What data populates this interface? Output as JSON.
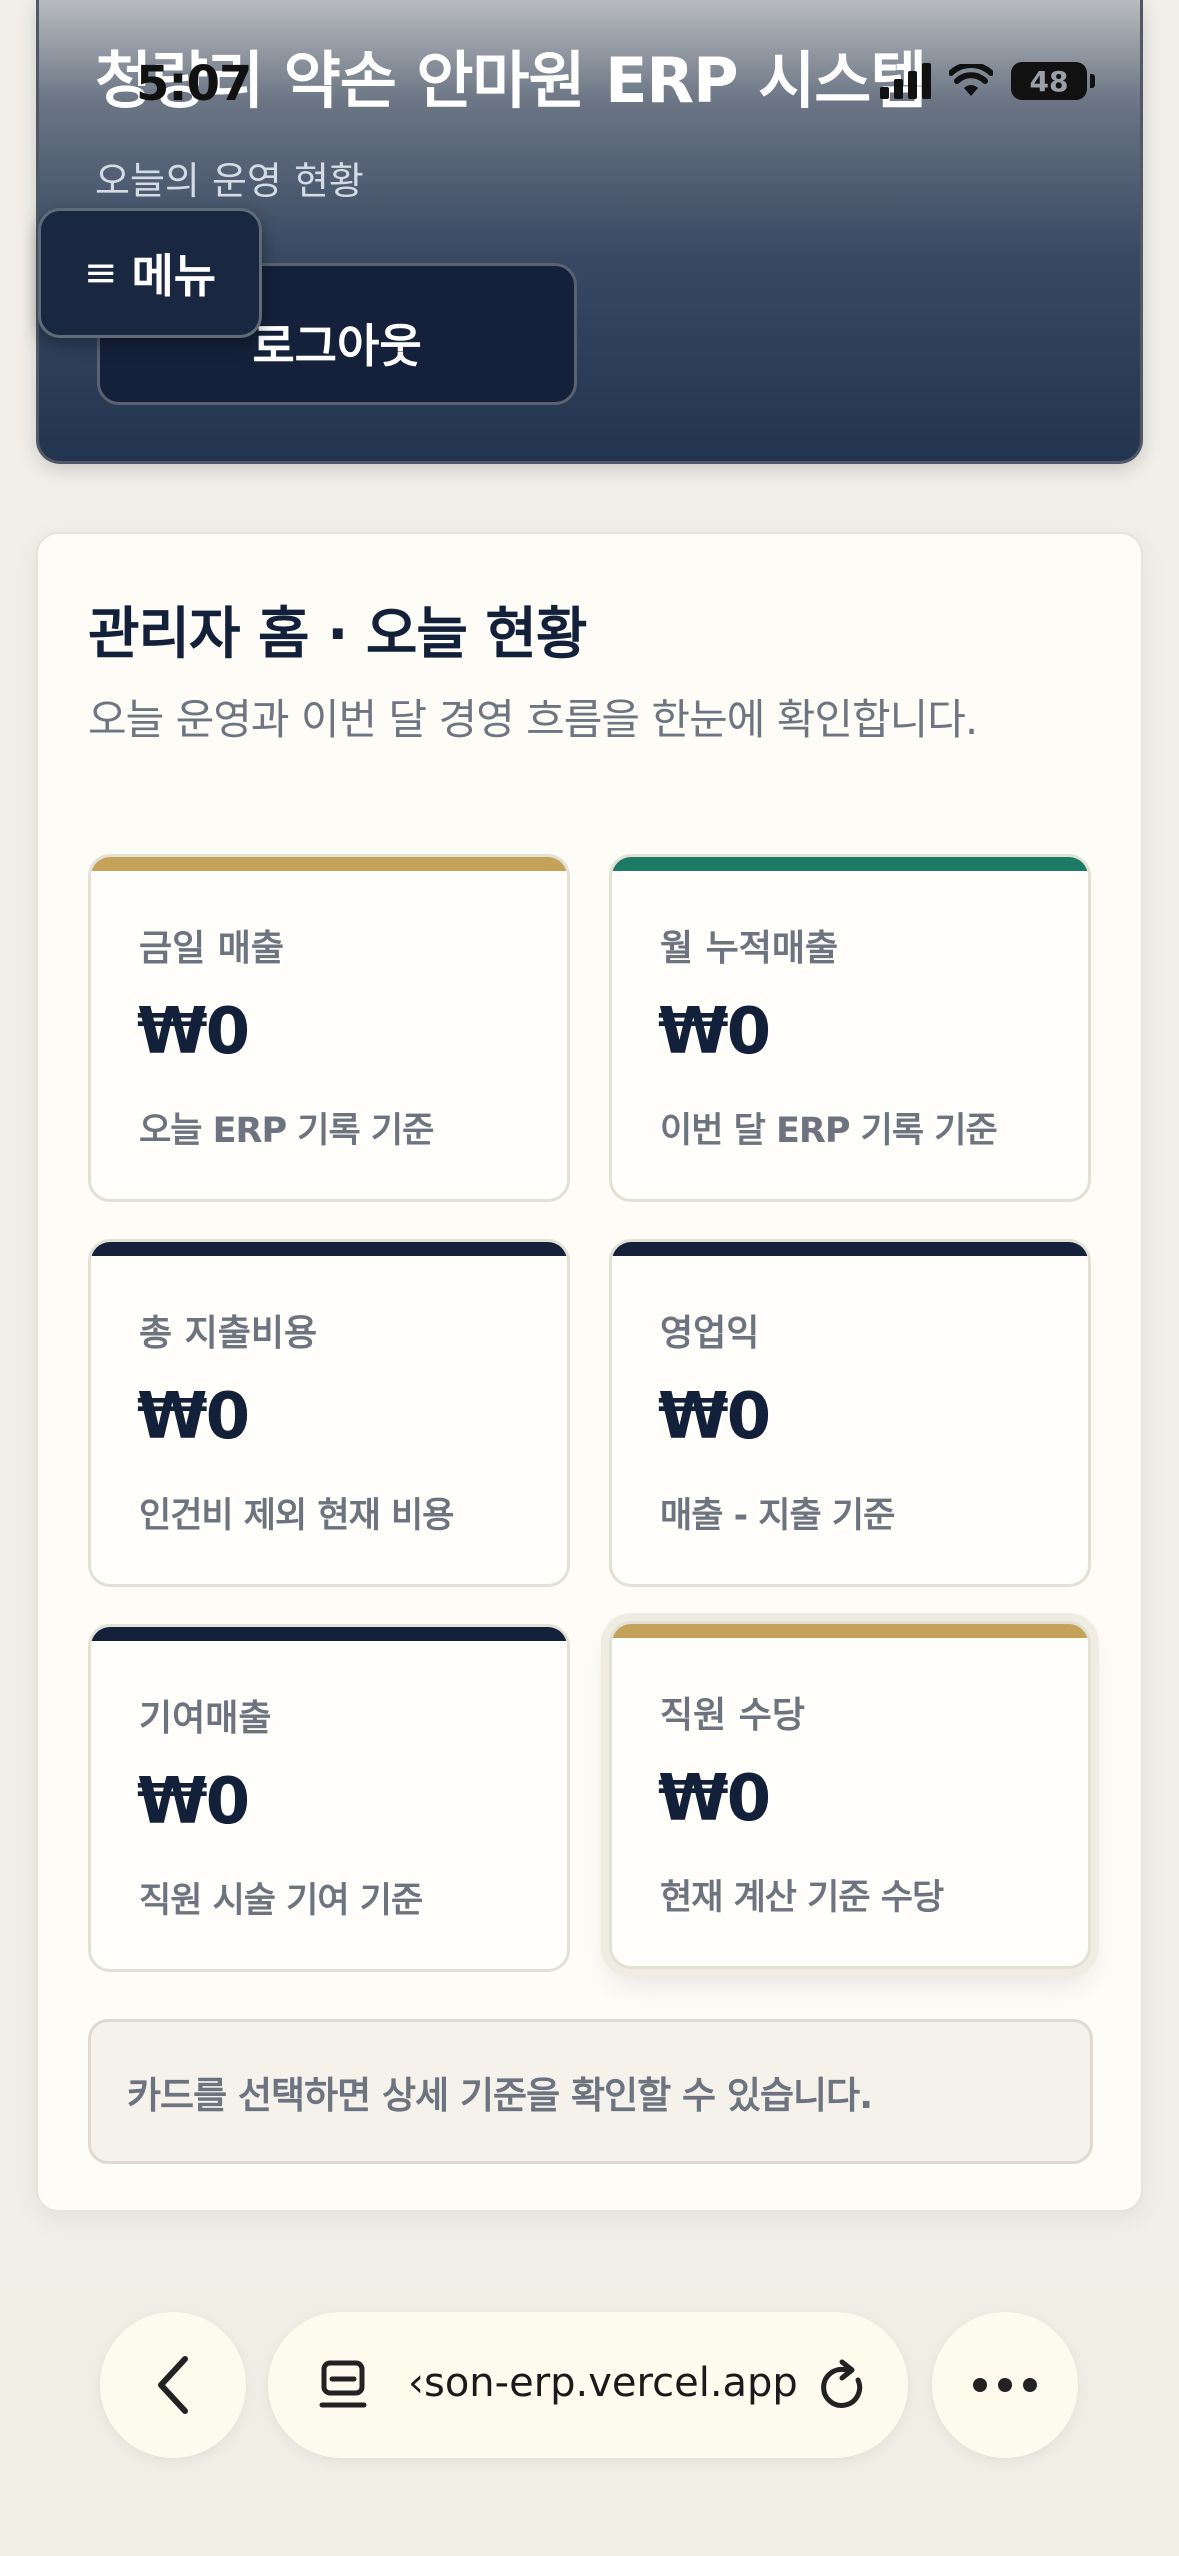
{
  "status_bar": {
    "time": "5:07",
    "battery": "48"
  },
  "header": {
    "title": "청량리 약손 안마원 ERP 시스템",
    "subtitle": "오늘의 운영 현황",
    "logout_label": "로그아웃",
    "menu_label": "메뉴",
    "menu_icon": "≡"
  },
  "main": {
    "title": "관리자 홈 · 오늘 현황",
    "description": "오늘 운영과 이번 달 경영 흐름을 한눈에 확인합니다.",
    "cards": [
      {
        "label": "금일 매출",
        "value": "₩0",
        "note": "오늘 ERP 기록 기준",
        "accent": "#c4a259"
      },
      {
        "label": "월 누적매출",
        "value": "₩0",
        "note": "이번 달 ERP 기록 기준",
        "accent": "#1d7a64"
      },
      {
        "label": "총 지출비용",
        "value": "₩0",
        "note": "인건비 제외 현재 비용",
        "accent": "#15213a"
      },
      {
        "label": "영업익",
        "value": "₩0",
        "note": "매출 - 지출 기준",
        "accent": "#15213a"
      },
      {
        "label": "기여매출",
        "value": "₩0",
        "note": "직원 시술 기여 기준",
        "accent": "#15213a"
      },
      {
        "label": "직원 수당",
        "value": "₩0",
        "note": "현재 계산 기준 수당",
        "accent": "#c4a259"
      }
    ],
    "hint": "카드를 선택하면 상세 기준을 확인할 수 있습니다."
  },
  "browser": {
    "url": "‹son-erp.vercel.app",
    "back_icon": "chevron-left-icon",
    "tabs_icon": "page-tabs-icon",
    "reload_icon": "reload-icon",
    "more_icon": "more-icon"
  }
}
